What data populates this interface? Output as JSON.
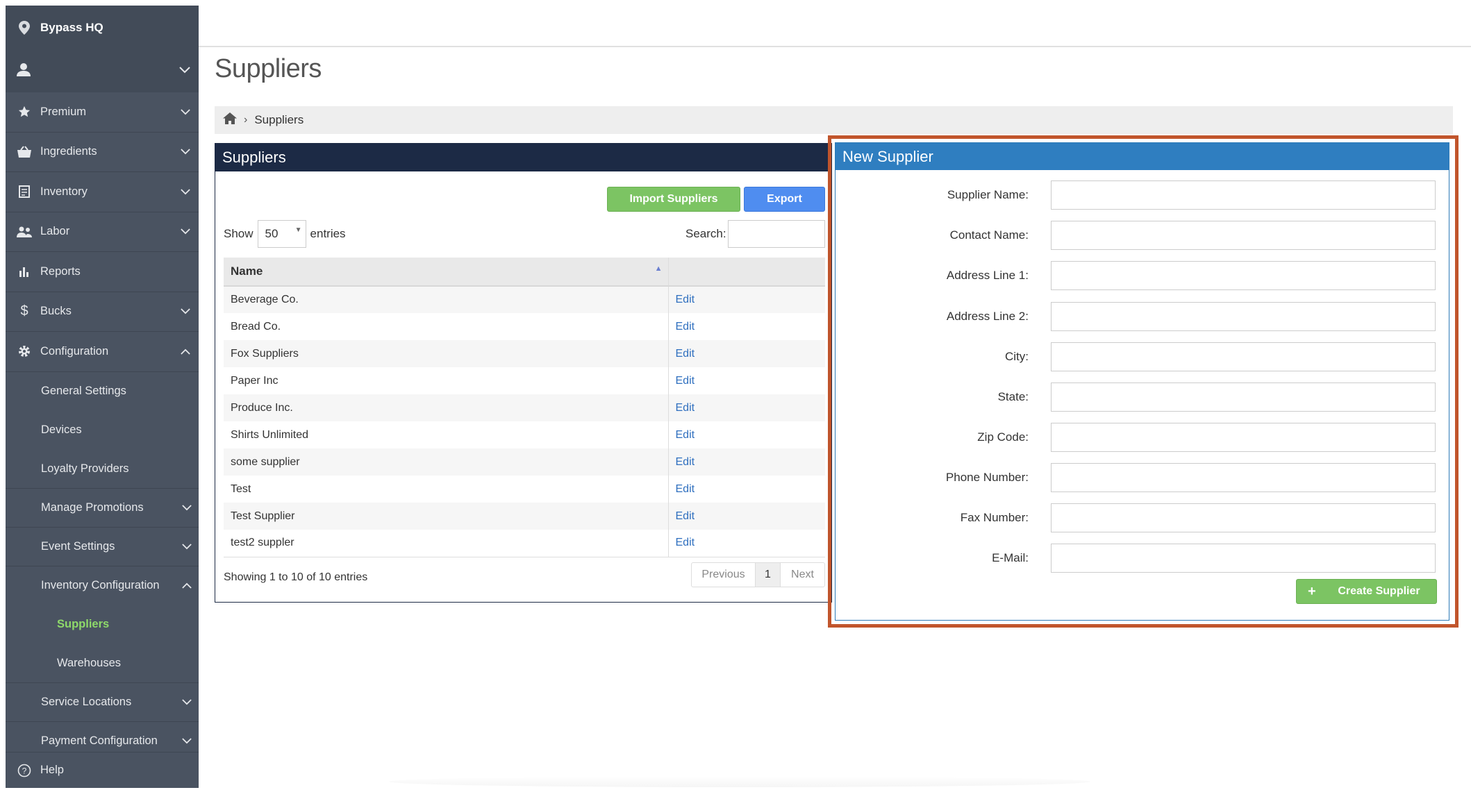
{
  "sidebar": {
    "location": "Bypass HQ",
    "items": [
      {
        "label": "Premium",
        "icon": "star-icon",
        "chevron": "down"
      },
      {
        "label": "Ingredients",
        "icon": "basket-icon",
        "chevron": "down"
      },
      {
        "label": "Inventory",
        "icon": "inventory-icon",
        "chevron": "down"
      },
      {
        "label": "Labor",
        "icon": "people-icon",
        "chevron": "down"
      },
      {
        "label": "Reports",
        "icon": "bar-chart-icon",
        "chevron": ""
      },
      {
        "label": "Bucks",
        "icon": "dollar-icon",
        "chevron": "down"
      },
      {
        "label": "Configuration",
        "icon": "gear-icon",
        "chevron": "up"
      }
    ],
    "config_subitems": [
      {
        "label": "General Settings"
      },
      {
        "label": "Devices"
      },
      {
        "label": "Loyalty Providers"
      },
      {
        "label": "Manage Promotions"
      },
      {
        "label": "Event Settings"
      },
      {
        "label": "Inventory Configuration"
      }
    ],
    "inventory_config_subitems": [
      {
        "label": "Suppliers"
      },
      {
        "label": "Warehouses"
      }
    ],
    "more_subitems": [
      {
        "label": "Service Locations"
      },
      {
        "label": "Payment Configuration"
      }
    ],
    "help": "Help"
  },
  "page": {
    "title": "Suppliers",
    "breadcrumb": {
      "current": "Suppliers"
    }
  },
  "suppliers_panel": {
    "title": "Suppliers",
    "import_label": "Import Suppliers",
    "export_label": "Export",
    "show_label": "Show",
    "show_value": "50",
    "entries_label": "entries",
    "search_label": "Search:",
    "column_name": "Name",
    "edit_label": "Edit",
    "rows": [
      "Beverage Co.",
      "Bread Co.",
      "Fox Suppliers",
      "Paper Inc",
      "Produce Inc.",
      "Shirts Unlimited",
      "some supplier",
      "Test",
      "Test Supplier",
      "test2 suppler"
    ],
    "showing_text": "Showing 1 to 10 of 10 entries",
    "pager": {
      "previous": "Previous",
      "page": "1",
      "next": "Next"
    }
  },
  "new_supplier": {
    "title": "New Supplier",
    "fields": [
      {
        "label": "Supplier Name:"
      },
      {
        "label": "Contact Name:"
      },
      {
        "label": "Address Line 1:"
      },
      {
        "label": "Address Line 2:"
      },
      {
        "label": "City:"
      },
      {
        "label": "State:"
      },
      {
        "label": "Zip Code:"
      },
      {
        "label": "Phone Number:"
      },
      {
        "label": "Fax Number:"
      },
      {
        "label": "E-Mail:"
      }
    ],
    "create_label": "Create Supplier"
  },
  "colors": {
    "sidebar_bg": "#4a5361",
    "panel_header_dark": "#1c2a45",
    "panel_header_blue": "#2f7ec0",
    "green_button": "#7cc463",
    "blue_button": "#4f8df0",
    "highlight": "#c1552c",
    "active_nav": "#8ed96a"
  }
}
